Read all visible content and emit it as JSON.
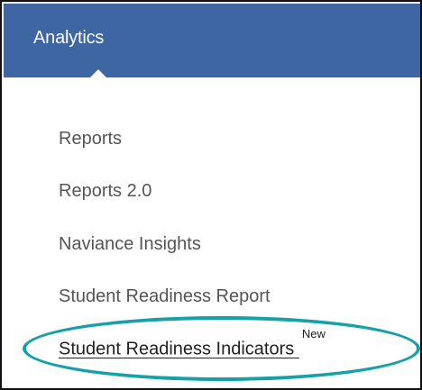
{
  "menu": {
    "title": "Analytics",
    "items": [
      {
        "label": "Reports"
      },
      {
        "label": "Reports 2.0"
      },
      {
        "label": "Naviance Insights"
      },
      {
        "label": "Student Readiness Report"
      },
      {
        "label": "Student Readiness Indicators",
        "badge": "New"
      }
    ]
  },
  "colors": {
    "header": "#3e66a3",
    "header_text": "#ffffff",
    "menu_text": "#555555",
    "highlight_ring": "#16a0a7"
  },
  "icons": {
    "menu_pointer": "caret-up-icon"
  }
}
